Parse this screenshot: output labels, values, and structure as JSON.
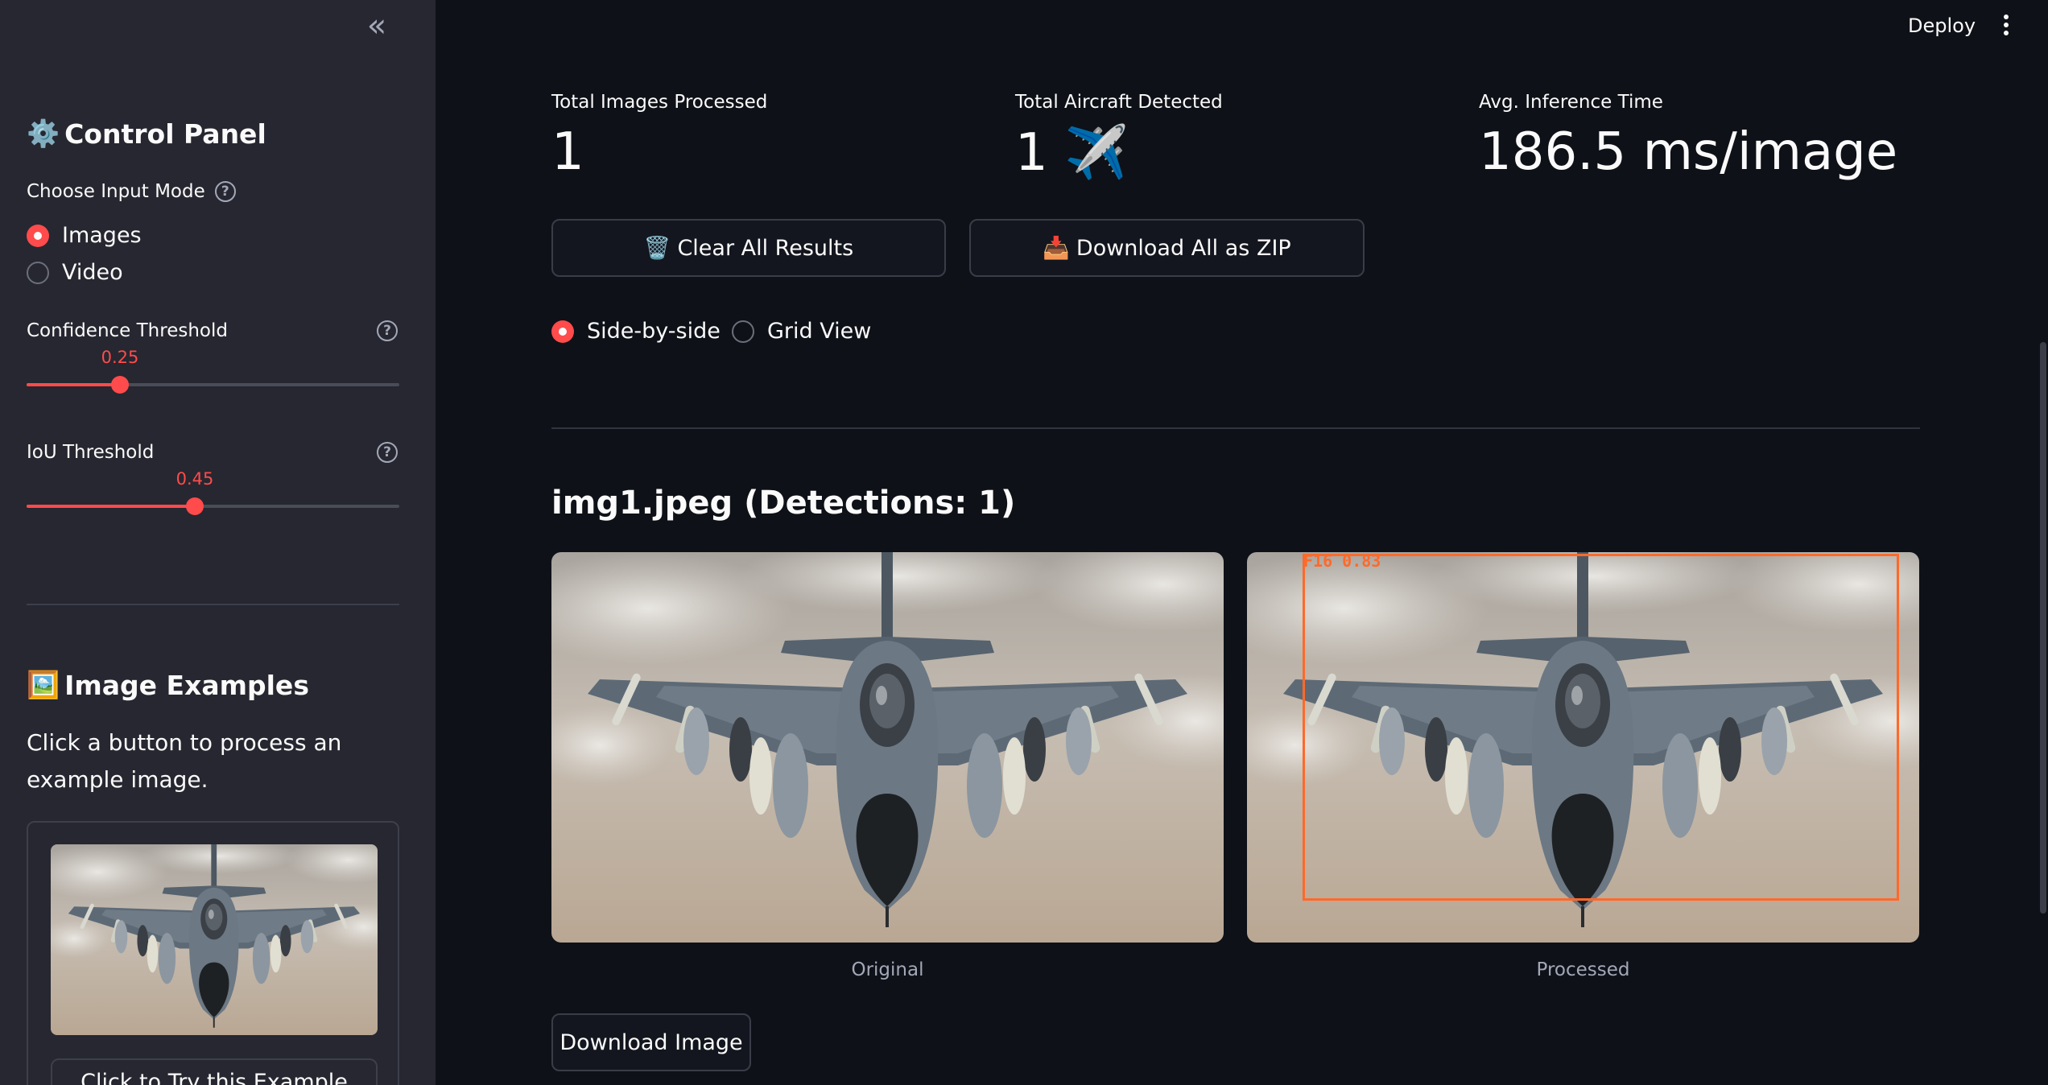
{
  "sidebar": {
    "control_panel_icon": "⚙️",
    "control_panel_title": "Control Panel",
    "input_mode_label": "Choose Input Mode",
    "input_modes": [
      {
        "label": "Images",
        "selected": true
      },
      {
        "label": "Video",
        "selected": false
      }
    ],
    "confidence": {
      "label": "Confidence Threshold",
      "value": "0.25",
      "fraction": 0.25
    },
    "iou": {
      "label": "IoU Threshold",
      "value": "0.45",
      "fraction": 0.45
    },
    "examples_icon": "🖼️",
    "examples_title": "Image Examples",
    "examples_text": "Click a button to process an example image.",
    "example_button": "Click to Try this Example"
  },
  "header": {
    "deploy_label": "Deploy"
  },
  "metrics": [
    {
      "label": "Total Images Processed",
      "value": "1"
    },
    {
      "label": "Total Aircraft Detected",
      "value": "1 ✈️"
    },
    {
      "label": "Avg. Inference Time",
      "value": "186.5 ms/image"
    }
  ],
  "actions": {
    "clear_icon": "🗑️",
    "clear_label": "Clear All Results",
    "download_zip_icon": "📥",
    "download_zip_label": "Download All as ZIP"
  },
  "view_modes": [
    {
      "label": "Side-by-side",
      "selected": true
    },
    {
      "label": "Grid View",
      "selected": false
    }
  ],
  "result": {
    "title": "img1.jpeg (Detections: 1)",
    "original_caption": "Original",
    "processed_caption": "Processed",
    "detection_label": "F16  0.83",
    "download_label": "Download Image"
  },
  "colors": {
    "accent": "#ff4b4b",
    "detection_box": "#ff6a2a",
    "sidebar_bg": "#262730",
    "main_bg": "#0e1117"
  }
}
